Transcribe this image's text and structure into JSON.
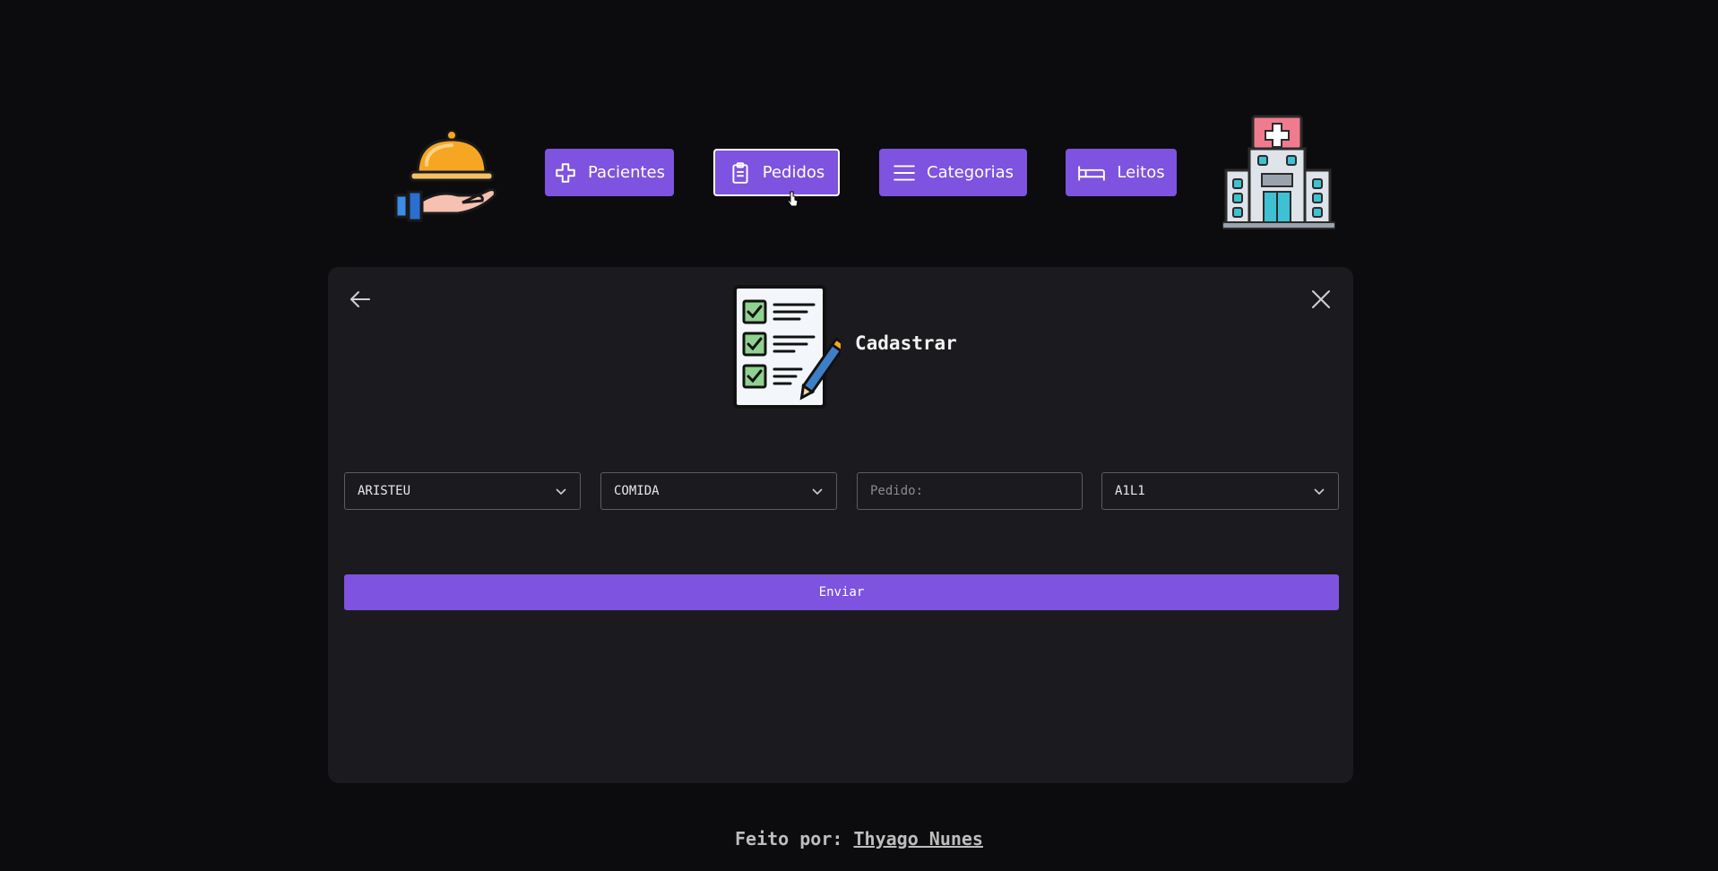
{
  "nav": {
    "items": [
      {
        "label": "Pacientes",
        "icon": "plus-outline-icon"
      },
      {
        "label": "Pedidos",
        "icon": "clipboard-icon",
        "active": true
      },
      {
        "label": "Categorias",
        "icon": "menu-lines-icon"
      },
      {
        "label": "Leitos",
        "icon": "bed-icon"
      }
    ],
    "left_logo_icon": "food-service-cloche-icon",
    "right_logo_icon": "hospital-building-icon"
  },
  "card": {
    "title": "Cadastrar",
    "illustration_icon": "checklist-icon",
    "fields": {
      "paciente": {
        "value": "ARISTEU"
      },
      "categoria": {
        "value": "COMIDA"
      },
      "pedido": {
        "value": "",
        "placeholder": "Pedido:"
      },
      "leito": {
        "value": "A1L1"
      }
    },
    "submit_label": "Enviar"
  },
  "footer": {
    "prefix": "Feito por:",
    "author": "Thyago Nunes"
  },
  "colors": {
    "accent": "#7e53df",
    "background": "#0c0c0e",
    "card": "#1b1b1f"
  }
}
